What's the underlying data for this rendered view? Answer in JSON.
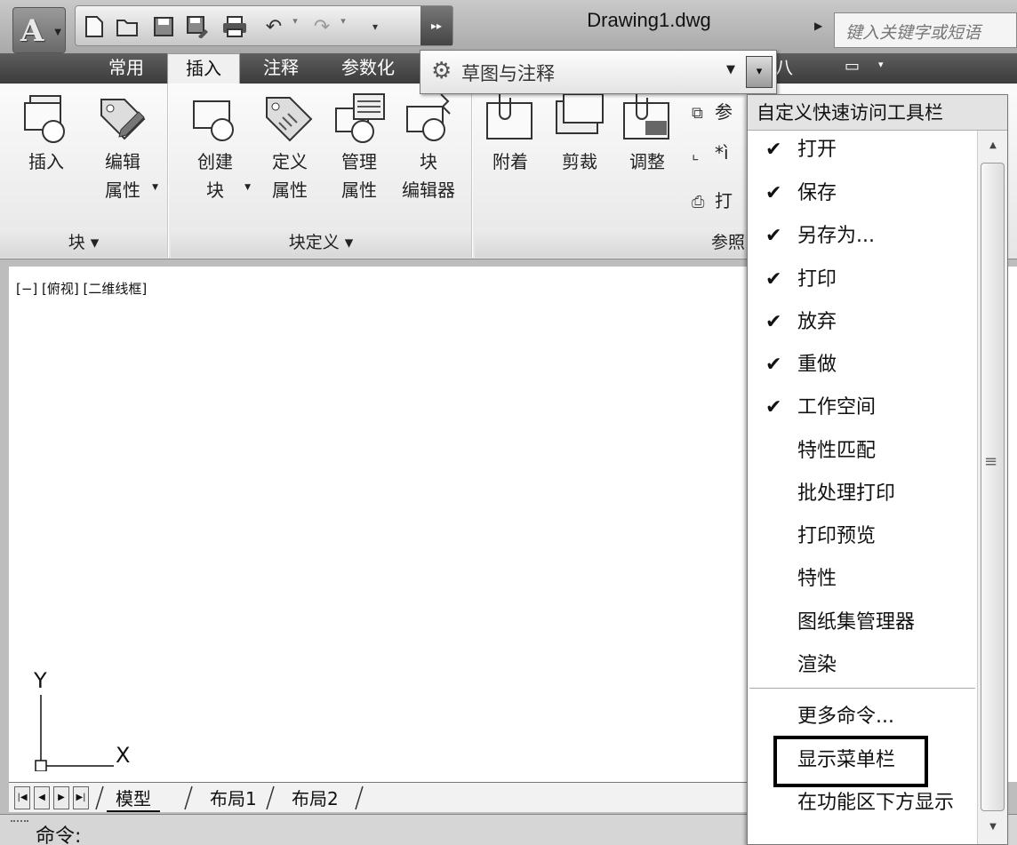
{
  "title_bar": {
    "app_menu": "A",
    "document_title": "Drawing1.dwg",
    "search_placeholder": "键入关键字或短语"
  },
  "quick_access_toolbar": {
    "icons": [
      "new-icon",
      "open-icon",
      "save-icon",
      "save-as-icon",
      "print-icon",
      "undo-icon",
      "redo-icon",
      "more-icon"
    ],
    "overflow": "▸▸"
  },
  "workspace": {
    "name": "草图与注释",
    "customize_arrow": "▾"
  },
  "tabs": [
    {
      "label": "常用",
      "active": false
    },
    {
      "label": "插入",
      "active": true
    },
    {
      "label": "注释",
      "active": false
    },
    {
      "label": "参数化",
      "active": false
    }
  ],
  "tab_partial": "八",
  "ribbon": {
    "panels": {
      "block": "块 ▾",
      "block_definition": "块定义 ▾",
      "reference": "参照"
    },
    "buttons": {
      "insert": "插入",
      "edit_attributes": "编辑\n属性",
      "create_block": "创建\n块",
      "define_attributes": "定义\n属性",
      "manage_attributes": "管理\n属性",
      "block_editor": "块\n编辑器",
      "attach": "附着",
      "clip": "剪裁",
      "adjust": "调整"
    },
    "small_buttons": [
      "参",
      "*ì",
      "打"
    ]
  },
  "viewport": {
    "label": "[−] [俯视] [二维线框]",
    "ucs_y": "Y",
    "ucs_x": "X"
  },
  "layout_tabs": {
    "nav": [
      "|◀",
      "◀",
      "▶",
      "▶|"
    ],
    "tabs": [
      "模型",
      "布局1",
      "布局2"
    ]
  },
  "command_line": {
    "prompt": "命令:"
  },
  "customize_menu": {
    "title": "自定义快速访问工具栏",
    "items": [
      {
        "label": "打开",
        "checked": true
      },
      {
        "label": "保存",
        "checked": true
      },
      {
        "label": "另存为...",
        "checked": true
      },
      {
        "label": "打印",
        "checked": true
      },
      {
        "label": "放弃",
        "checked": true
      },
      {
        "label": "重做",
        "checked": true
      },
      {
        "label": "工作空间",
        "checked": true
      },
      {
        "label": "特性匹配",
        "checked": false
      },
      {
        "label": "批处理打印",
        "checked": false
      },
      {
        "label": "打印预览",
        "checked": false
      },
      {
        "label": "特性",
        "checked": false
      },
      {
        "label": "图纸集管理器",
        "checked": false
      },
      {
        "label": "渲染",
        "checked": false
      }
    ],
    "extra": [
      "更多命令...",
      "显示菜单栏",
      "在功能区下方显示"
    ],
    "check_glyph": "✔",
    "highlighted": "显示菜单栏"
  }
}
